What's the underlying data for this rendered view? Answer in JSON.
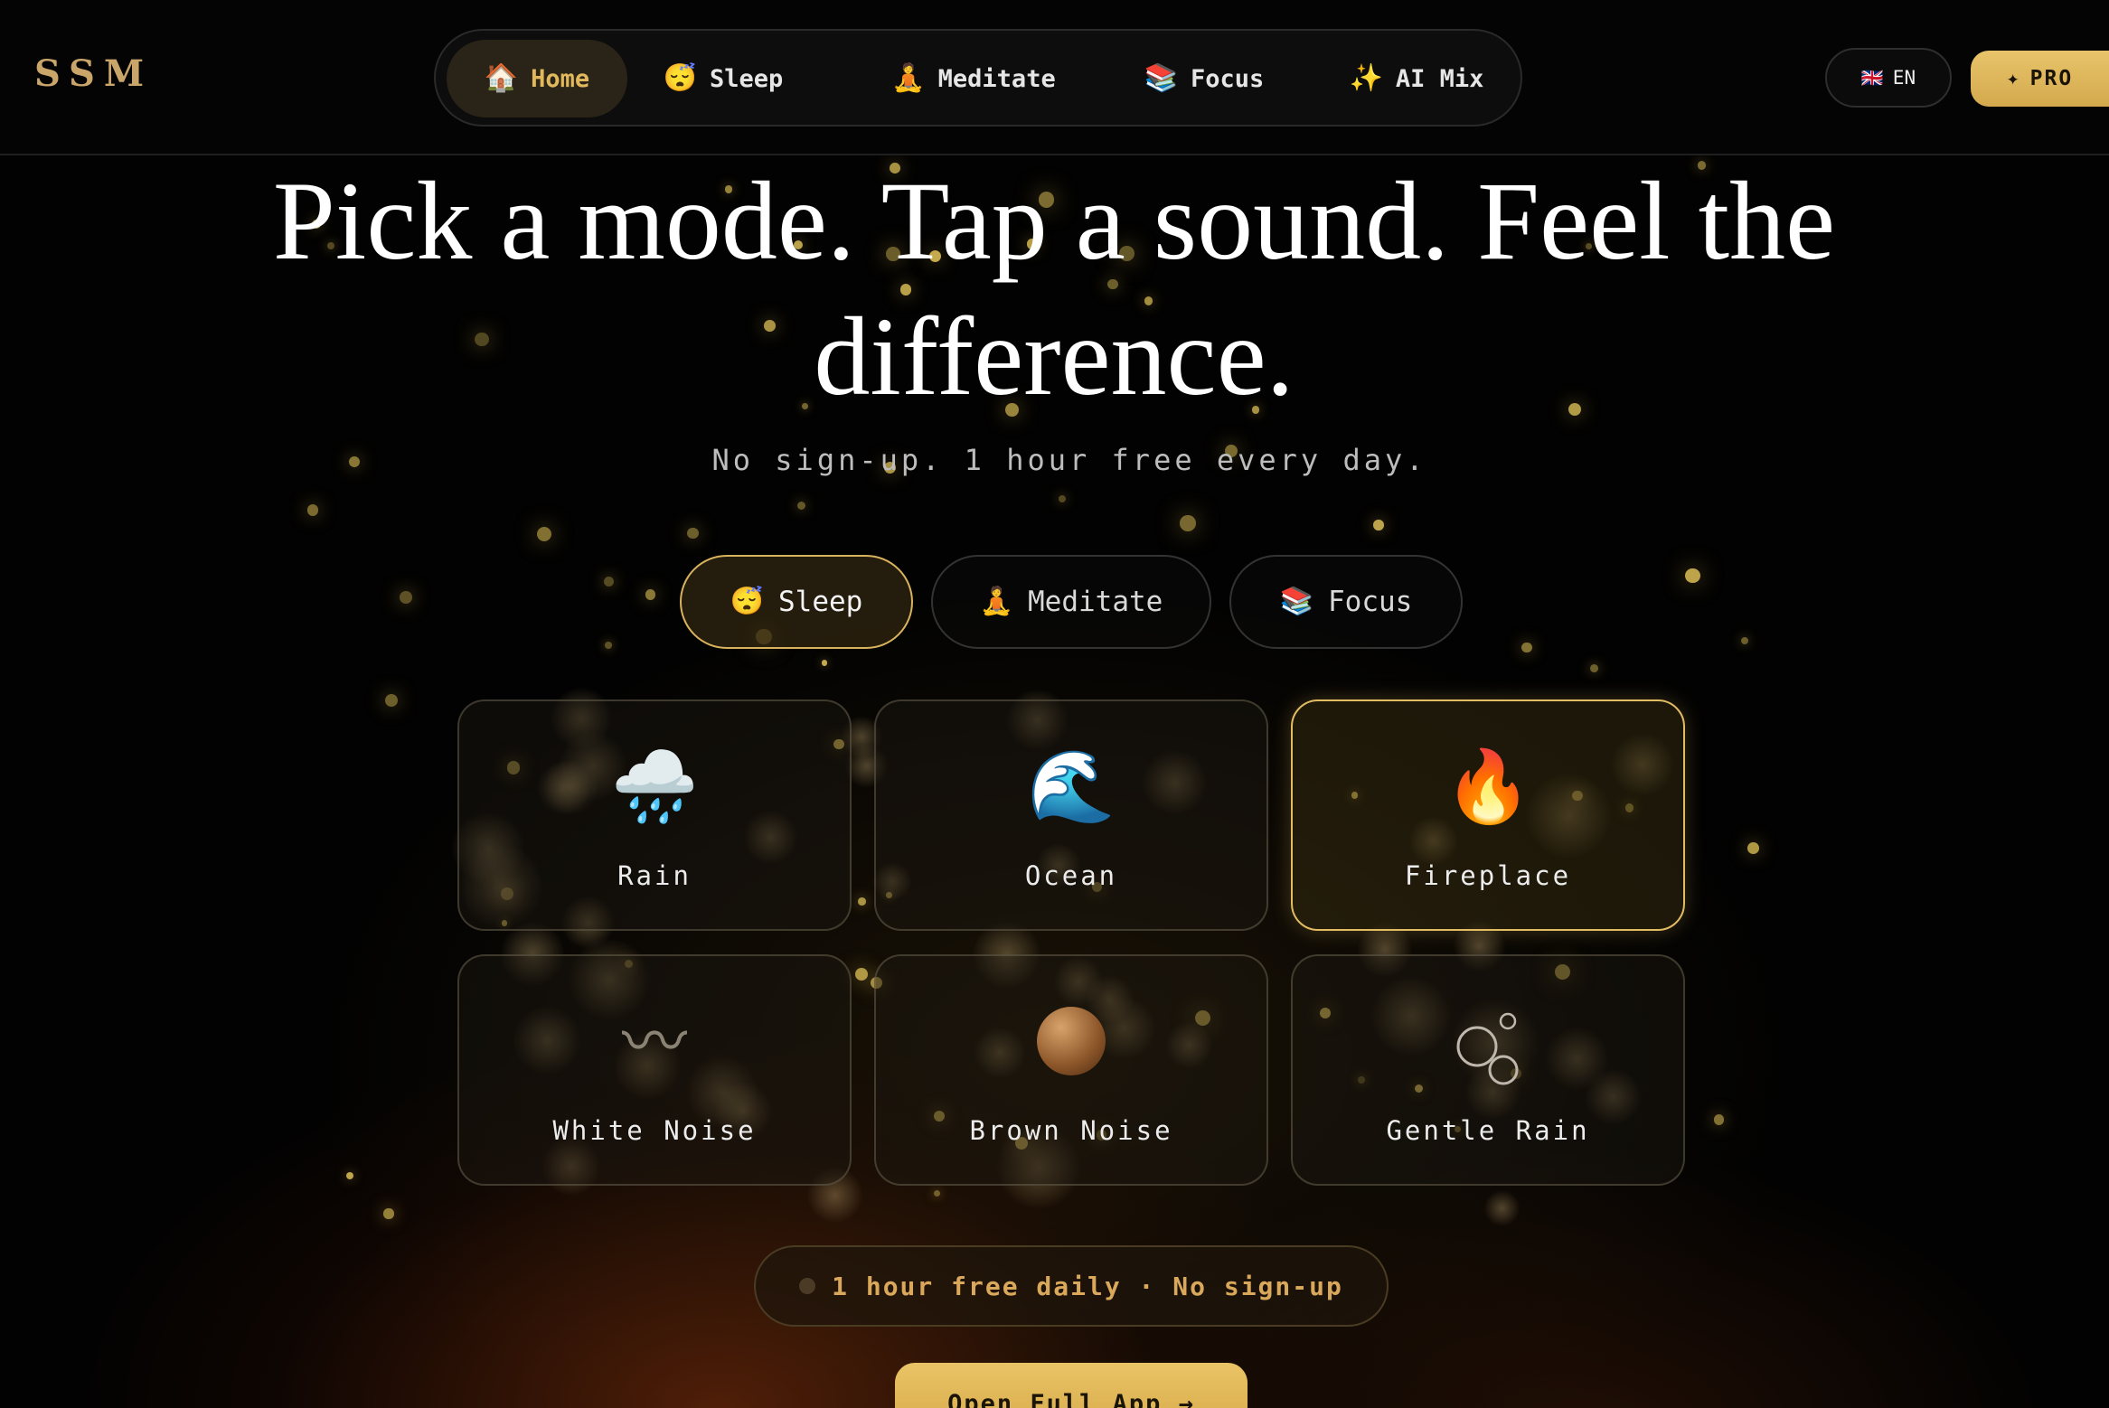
{
  "brand": {
    "logo": "SSM"
  },
  "nav": {
    "items": [
      {
        "icon": "🏠",
        "label": "Home",
        "active": true
      },
      {
        "icon": "😴",
        "label": "Sleep"
      },
      {
        "icon": "🧘",
        "label": "Meditate"
      },
      {
        "icon": "📚",
        "label": "Focus"
      },
      {
        "icon": "✨",
        "label": "AI Mix"
      }
    ]
  },
  "language": {
    "flag": "🇬🇧",
    "label": "EN"
  },
  "pro": {
    "icon": "✦",
    "label": "PRO"
  },
  "hero": {
    "title": "Pick a mode. Tap a sound. Feel the difference.",
    "subtitle": "No sign-up. 1 hour free every day."
  },
  "modes": [
    {
      "icon": "😴",
      "label": "Sleep",
      "active": true
    },
    {
      "icon": "🧘",
      "label": "Meditate"
    },
    {
      "icon": "📚",
      "label": "Focus"
    }
  ],
  "sounds": [
    {
      "icon": "🌧️",
      "label": "Rain"
    },
    {
      "icon": "🌊",
      "label": "Ocean"
    },
    {
      "icon": "🔥",
      "label": "Fireplace",
      "active": true
    },
    {
      "icon": "〰",
      "label": "White Noise"
    },
    {
      "icon": "●",
      "label": "Brown Noise"
    },
    {
      "icon": "○",
      "label": "Gentle Rain"
    }
  ],
  "footer": {
    "free_notice": "1 hour free daily · No sign-up",
    "open_app_label": "Open Full App →"
  },
  "colors": {
    "accent": "#e2b85c",
    "background": "#020202"
  }
}
